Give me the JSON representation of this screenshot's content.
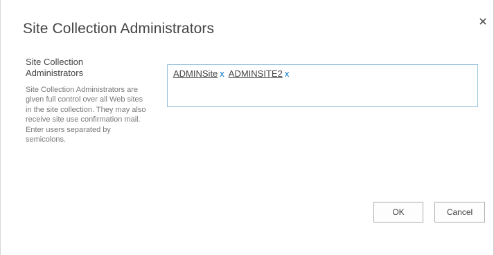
{
  "dialog": {
    "title": "Site Collection Administrators",
    "close_icon": "close-icon"
  },
  "section": {
    "title": "Site Collection Administrators",
    "description": "Site Collection Administrators are given full control over all Web sites in the site collection. They may also receive site use confirmation mail. Enter users separated by semicolons."
  },
  "picker": {
    "entities": [
      {
        "name": "ADMINSite",
        "remove": "x"
      },
      {
        "name": "ADMINSITE2",
        "remove": "x"
      }
    ]
  },
  "buttons": {
    "ok": "OK",
    "cancel": "Cancel"
  },
  "colors": {
    "accent": "#0072c6",
    "picker_border": "#92c0e0"
  }
}
